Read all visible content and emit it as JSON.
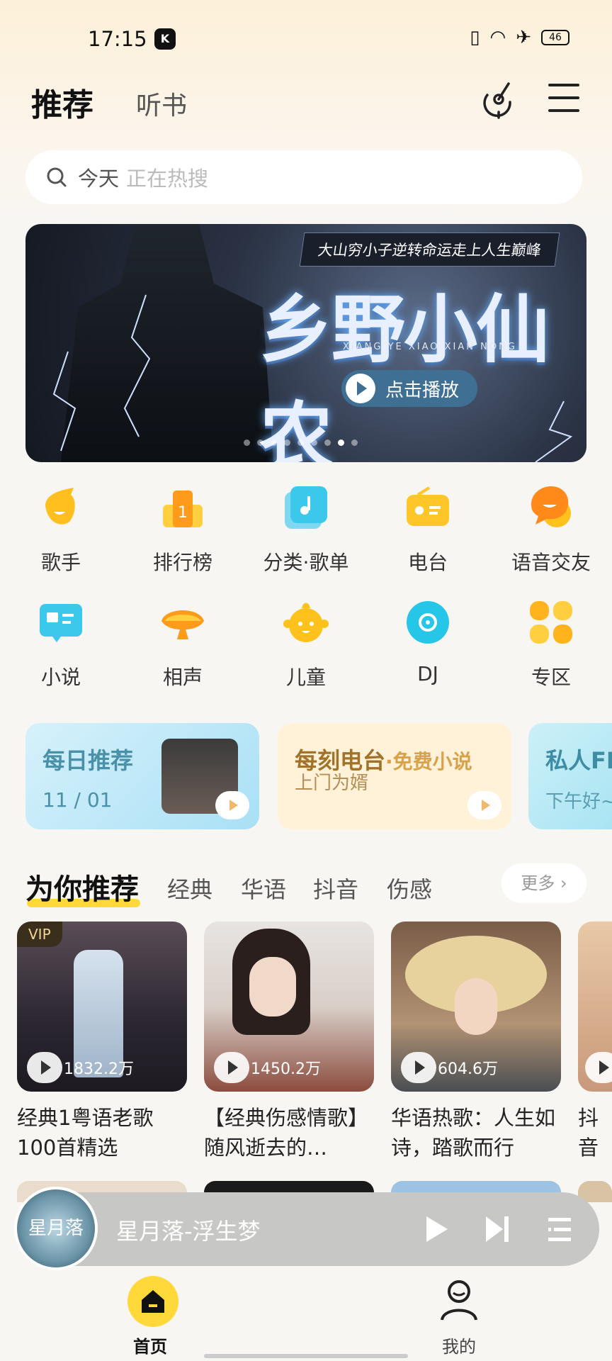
{
  "status": {
    "time": "17:15",
    "battery": "46"
  },
  "header": {
    "tab_active": "推荐",
    "tab_2": "听书"
  },
  "search": {
    "query": "今天",
    "placeholder": "正在热搜"
  },
  "banner": {
    "tagline": "大山穷小子逆转命运走上人生巅峰",
    "title": "乡野小仙农",
    "subtitle": "XIANG  YE      XIAO  XIAN  NONG",
    "play_label": "点击播放",
    "dots": 9,
    "active_dot": 7
  },
  "grid": {
    "row1": [
      "歌手",
      "排行榜",
      "分类·歌单",
      "电台",
      "语音交友"
    ],
    "row2": [
      "小说",
      "相声",
      "儿童",
      "DJ",
      "专区"
    ],
    "icons": {
      "row1": [
        "singer-icon",
        "ranking-icon",
        "category-icon",
        "radio-icon",
        "voice-chat-icon"
      ],
      "row2": [
        "novel-icon",
        "crosstalk-icon",
        "children-icon",
        "dj-icon",
        "zone-icon"
      ]
    }
  },
  "cards": {
    "daily": {
      "title": "每日推荐",
      "date": "11 / 01"
    },
    "radio": {
      "title": "每刻电台",
      "title_suffix": "·免费小说",
      "subtitle": "上门为婿"
    },
    "fm": {
      "title": "私人FM",
      "subtitle": "下午好~"
    }
  },
  "recommend": {
    "title": "为你推荐",
    "tabs": [
      "经典",
      "华语",
      "抖音",
      "伤感"
    ],
    "more": "更多"
  },
  "playlists": [
    {
      "title": "经典1粤语老歌100首精选",
      "plays": "1832.2万",
      "vip": "VIP"
    },
    {
      "title": "【经典伤感情歌】随风逝去的…",
      "plays": "1450.2万"
    },
    {
      "title": "华语热歌：人生如诗，踏歌而行",
      "plays": "604.6万"
    },
    {
      "title": "抖音你跑",
      "plays": ""
    }
  ],
  "player": {
    "song": "星月落-浮生梦",
    "cover_text": "星月落"
  },
  "nav": {
    "home": "首页",
    "me": "我的"
  },
  "colors": {
    "accent": "#ffd83a",
    "background": "#f8f6f3"
  }
}
